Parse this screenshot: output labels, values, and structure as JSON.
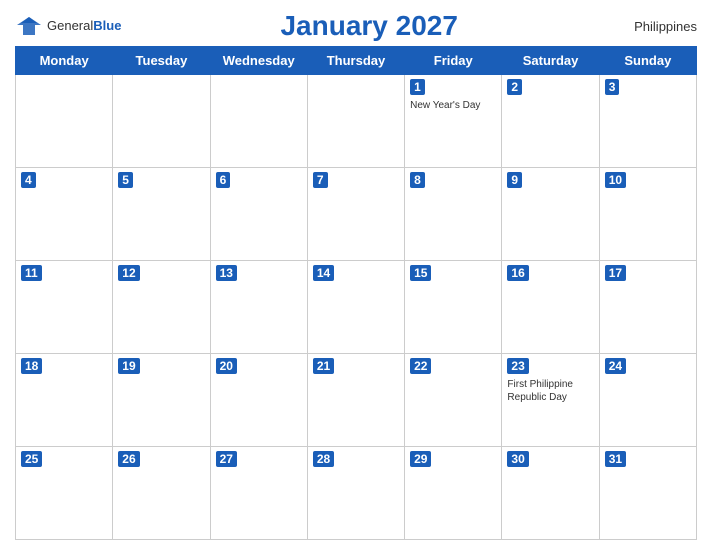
{
  "header": {
    "logo_general": "General",
    "logo_blue": "Blue",
    "title": "January 2027",
    "country": "Philippines"
  },
  "weekdays": [
    "Monday",
    "Tuesday",
    "Wednesday",
    "Thursday",
    "Friday",
    "Saturday",
    "Sunday"
  ],
  "weeks": [
    [
      {
        "day": null
      },
      {
        "day": null
      },
      {
        "day": null
      },
      {
        "day": null
      },
      {
        "day": 1,
        "holiday": "New Year's Day"
      },
      {
        "day": 2
      },
      {
        "day": 3
      }
    ],
    [
      {
        "day": 4
      },
      {
        "day": 5
      },
      {
        "day": 6
      },
      {
        "day": 7
      },
      {
        "day": 8
      },
      {
        "day": 9
      },
      {
        "day": 10
      }
    ],
    [
      {
        "day": 11
      },
      {
        "day": 12
      },
      {
        "day": 13
      },
      {
        "day": 14
      },
      {
        "day": 15
      },
      {
        "day": 16
      },
      {
        "day": 17
      }
    ],
    [
      {
        "day": 18
      },
      {
        "day": 19
      },
      {
        "day": 20
      },
      {
        "day": 21
      },
      {
        "day": 22
      },
      {
        "day": 23,
        "holiday": "First Philippine Republic Day"
      },
      {
        "day": 24
      }
    ],
    [
      {
        "day": 25
      },
      {
        "day": 26
      },
      {
        "day": 27
      },
      {
        "day": 28
      },
      {
        "day": 29
      },
      {
        "day": 30
      },
      {
        "day": 31
      }
    ]
  ]
}
